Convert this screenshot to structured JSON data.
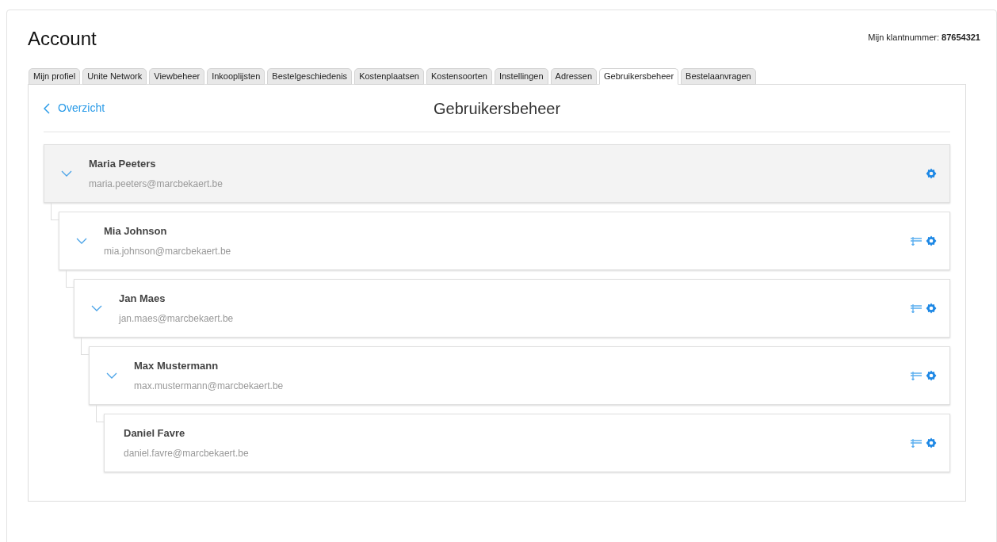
{
  "title": "Account",
  "customer_number": {
    "label": "Mijn klantnummer:",
    "value": "87654321"
  },
  "tabs": [
    {
      "label": "Mijn profiel",
      "selected": false
    },
    {
      "label": "Unite Network",
      "selected": false
    },
    {
      "label": "Viewbeheer",
      "selected": false
    },
    {
      "label": "Inkooplijsten",
      "selected": false
    },
    {
      "label": "Bestelgeschiedenis",
      "selected": false
    },
    {
      "label": "Kostenplaatsen",
      "selected": false
    },
    {
      "label": "Kostensoorten",
      "selected": false
    },
    {
      "label": "Instellingen",
      "selected": false
    },
    {
      "label": "Adressen",
      "selected": false
    },
    {
      "label": "Gebruikersbeheer",
      "selected": true
    },
    {
      "label": "Bestelaanvragen",
      "selected": false
    }
  ],
  "back_link": "Overzicht",
  "heading": "Gebruikersbeheer",
  "users": [
    {
      "name": "Maria Peeters",
      "email": "maria.peeters@marcbekaert.be",
      "selected": true,
      "children": [
        {
          "name": "Mia Johnson",
          "email": "mia.johnson@marcbekaert.be",
          "selected": false,
          "children": [
            {
              "name": "Jan Maes",
              "email": "jan.maes@marcbekaert.be",
              "selected": false,
              "children": [
                {
                  "name": "Max Mustermann",
                  "email": "max.mustermann@marcbekaert.be",
                  "selected": false,
                  "children": [
                    {
                      "name": "Daniel Favre",
                      "email": "daniel.favre@marcbekaert.be",
                      "selected": false
                    }
                  ]
                }
              ]
            }
          ]
        }
      ]
    }
  ]
}
